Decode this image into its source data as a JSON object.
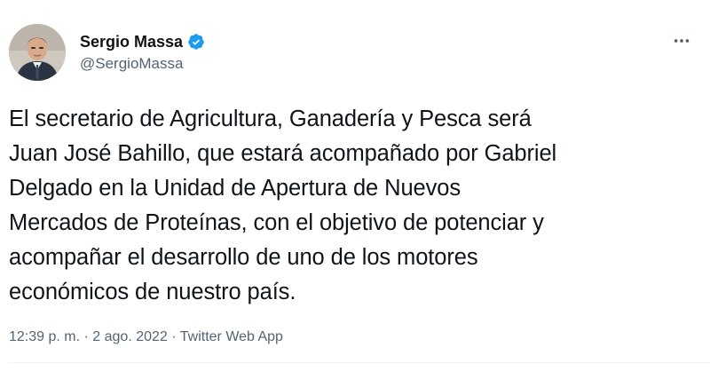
{
  "author": {
    "display_name": "Sergio Massa",
    "handle": "@SergioMassa",
    "verified": true
  },
  "tweet": {
    "lines": [
      "El secretario de Agricultura, Ganadería y Pesca será",
      "Juan José Bahillo, que estará acompañado por Gabriel",
      "Delgado en la Unidad de Apertura de Nuevos",
      "Mercados de Proteínas, con el objetivo de potenciar y",
      "acompañar el desarrollo de uno de los motores",
      "económicos de nuestro país."
    ]
  },
  "meta": {
    "time": "12:39 p. m.",
    "separator": "·",
    "date": "2 ago. 2022",
    "source": "Twitter Web App"
  },
  "icons": {
    "verified": "verified-badge-icon",
    "more": "more-horizontal-icon"
  },
  "colors": {
    "text": "#0f1419",
    "secondary": "#536471",
    "verified": "#1d9bf0"
  }
}
